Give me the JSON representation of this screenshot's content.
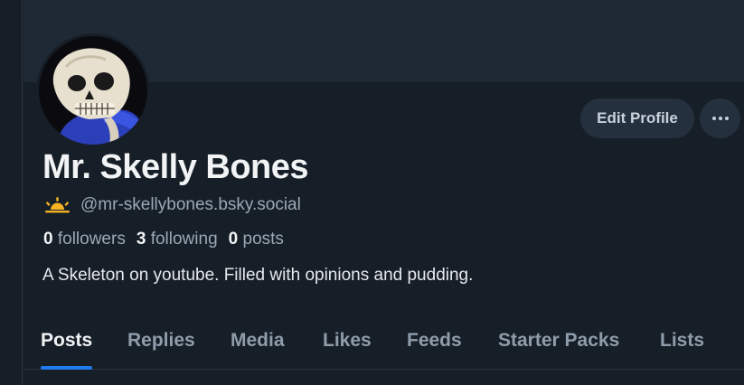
{
  "profile": {
    "display_name": "Mr. Skelly Bones",
    "handle": "@mr-skellybones.bsky.social",
    "bio": "A Skeleton on youtube. Filled with opinions and pudding.",
    "stats": {
      "followers_count": "0",
      "followers_label": "followers",
      "following_count": "3",
      "following_label": "following",
      "posts_count": "0",
      "posts_label": "posts"
    }
  },
  "actions": {
    "edit_profile_label": "Edit Profile",
    "more_icon": "ellipsis-icon"
  },
  "tabs": [
    {
      "label": "Posts",
      "active": true
    },
    {
      "label": "Replies",
      "active": false
    },
    {
      "label": "Media",
      "active": false
    },
    {
      "label": "Likes",
      "active": false
    },
    {
      "label": "Feeds",
      "active": false
    },
    {
      "label": "Starter Packs",
      "active": false
    },
    {
      "label": "Lists",
      "active": false
    }
  ],
  "colors": {
    "background": "#161e27",
    "banner": "#1f2935",
    "accent": "#1f7cf0",
    "badge": "#f5b324"
  },
  "icons": {
    "handle_badge": "sunrise-icon",
    "avatar": "skull-avatar"
  }
}
